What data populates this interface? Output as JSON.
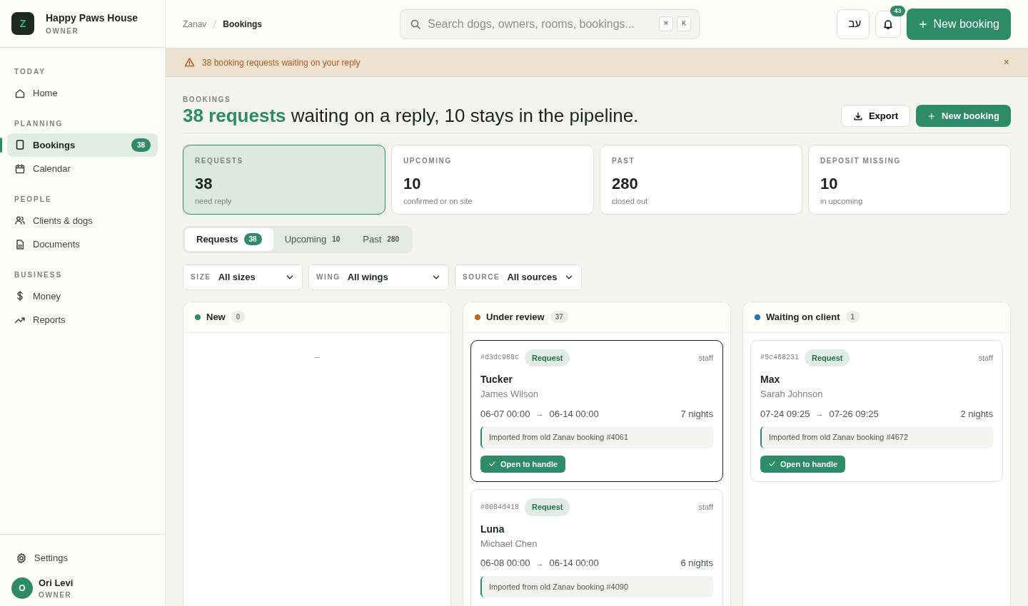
{
  "brand": {
    "logo_letter": "Z",
    "name": "Happy Paws House",
    "role": "OWNER"
  },
  "sidebar": {
    "sections": [
      {
        "title": "TODAY",
        "items": [
          {
            "label": "Home",
            "selected": false
          }
        ]
      },
      {
        "title": "PLANNING",
        "items": [
          {
            "label": "Bookings",
            "selected": true,
            "badge": "38"
          },
          {
            "label": "Calendar",
            "selected": false
          }
        ]
      },
      {
        "title": "PEOPLE",
        "items": [
          {
            "label": "Clients & dogs",
            "selected": false
          },
          {
            "label": "Documents",
            "selected": false
          }
        ]
      },
      {
        "title": "BUSINESS",
        "items": [
          {
            "label": "Money",
            "selected": false
          },
          {
            "label": "Reports",
            "selected": false
          }
        ]
      }
    ],
    "settings": "Settings",
    "user": {
      "initial": "O",
      "name": "Ori Levi",
      "role": "OWNER"
    }
  },
  "breadcrumb": [
    "Zanav",
    "Bookings"
  ],
  "search": {
    "placeholder": "Search dogs, owners, rooms, bookings...",
    "keys": [
      "⌘",
      "K"
    ]
  },
  "language_button": "עב",
  "notifications": {
    "count": "43"
  },
  "new_booking_top": "New booking",
  "banner": {
    "text": "38 booking requests waiting on your reply",
    "close": "×"
  },
  "page": {
    "eyebrow": "BOOKINGS",
    "heading": "**38 requests** waiting on a reply, 10 stays in the pipeline.",
    "export": "Export",
    "new_booking": "New booking"
  },
  "stats": [
    {
      "label": "REQUESTS",
      "value": "38",
      "note": "need reply",
      "selected": true
    },
    {
      "label": "UPCOMING",
      "value": "10",
      "note": "confirmed or on site",
      "selected": false
    },
    {
      "label": "PAST",
      "value": "280",
      "note": "closed out",
      "selected": false
    },
    {
      "label": "DEPOSIT MISSING",
      "value": "10",
      "note": "in upcoming",
      "selected": false
    }
  ],
  "tabs": [
    {
      "label": "Requests",
      "count": "38",
      "selected": true
    },
    {
      "label": "Upcoming",
      "count": "10",
      "selected": false
    },
    {
      "label": "Past",
      "count": "280",
      "selected": false
    }
  ],
  "filters": [
    {
      "label": "SIZE",
      "value": "All sizes"
    },
    {
      "label": "WING",
      "value": "All wings"
    },
    {
      "label": "SOURCE",
      "value": "All sources"
    }
  ],
  "columns": [
    {
      "title": "New",
      "count": "0",
      "color": "#2e8b6a",
      "empty_mark": "–"
    },
    {
      "title": "Under review",
      "count": "37",
      "color": "#c0641f",
      "cards": [
        {
          "id": "#d3dc988c",
          "tag": "Request",
          "by": "staff",
          "dog": "Tucker",
          "owner": "James Wilson",
          "from": "06-07 00:00",
          "arrow": "→",
          "to": "06-14 00:00",
          "nights": "7 nights",
          "note": "Imported from old Zanav booking #4061",
          "action": "Open to handle",
          "selected": true
        },
        {
          "id": "#0084d418",
          "tag": "Request",
          "by": "staff",
          "dog": "Luna",
          "owner": "Michael Chen",
          "from": "06-08 00:00",
          "arrow": "→",
          "to": "06-14 00:00",
          "nights": "6 nights",
          "note": "Imported from old Zanav booking #4090",
          "selected": false
        }
      ]
    },
    {
      "title": "Waiting on client",
      "count": "1",
      "color": "#2f6db5",
      "cards": [
        {
          "id": "#5c468231",
          "tag": "Request",
          "by": "staff",
          "dog": "Max",
          "owner": "Sarah Johnson",
          "from": "07-24 09:25",
          "arrow": "→",
          "to": "07-26 09:25",
          "nights": "2 nights",
          "note": "Imported from old Zanav booking #4672",
          "action": "Open to handle",
          "selected": false
        }
      ]
    }
  ]
}
